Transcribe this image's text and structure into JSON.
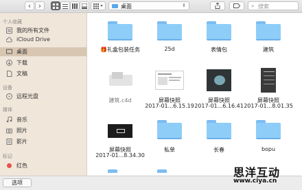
{
  "toolbar": {
    "back": "‹",
    "forward": "›",
    "path_label": "桌面",
    "path_arrow": "⌃",
    "search_placeholder": "搜索"
  },
  "sidebar": {
    "sections": [
      {
        "title": "个人收藏",
        "items": [
          {
            "label": "我的所有文件",
            "icon": "all-files-icon"
          },
          {
            "label": "iCloud Drive",
            "icon": "cloud-icon"
          },
          {
            "label": "桌面",
            "icon": "desktop-icon",
            "selected": true
          },
          {
            "label": "下载",
            "icon": "download-icon"
          },
          {
            "label": "文稿",
            "icon": "document-icon"
          }
        ]
      },
      {
        "title": "设备",
        "items": [
          {
            "label": "远程光盘",
            "icon": "disc-icon"
          }
        ]
      },
      {
        "title": "媒体",
        "items": [
          {
            "label": "音乐",
            "icon": "music-icon"
          },
          {
            "label": "照片",
            "icon": "camera-icon"
          },
          {
            "label": "影片",
            "icon": "film-icon"
          }
        ]
      },
      {
        "title": "标记",
        "items": [
          {
            "label": "红色",
            "icon": "red-tag-icon"
          }
        ]
      }
    ]
  },
  "files": [
    {
      "name": "🎁礼盒包装任务",
      "kind": "folder"
    },
    {
      "name": "25d",
      "kind": "folder"
    },
    {
      "name": "表情包",
      "kind": "folder"
    },
    {
      "name": "建筑",
      "kind": "folder"
    },
    {
      "name": "建筑.c4d",
      "kind": "c4d"
    },
    {
      "name": "屏幕快照",
      "name2": "2017-01...6.15.19",
      "kind": "screenshot"
    },
    {
      "name": "屏幕快照",
      "name2": "2017-01...6.16.41",
      "kind": "screenshot-dark"
    },
    {
      "name": "屏幕快照",
      "name2": "2017-01...8.01.35",
      "kind": "screenshot-tall"
    },
    {
      "name": "屏幕快照",
      "name2": "2017-01...8.34.30",
      "kind": "screenshot-black"
    },
    {
      "name": "私单",
      "kind": "folder"
    },
    {
      "name": "长春",
      "kind": "folder"
    },
    {
      "name": "bopu",
      "kind": "folder"
    }
  ],
  "bottom": {
    "options_label": "选项"
  },
  "watermark": {
    "title": "思洋互动",
    "url": "www.ciya.cn"
  },
  "colors": {
    "folder": "#8ecdf8",
    "sidebar_bg": "#f0e6da",
    "selected": "#d9c6b2",
    "red_tag": "#e5534b"
  }
}
